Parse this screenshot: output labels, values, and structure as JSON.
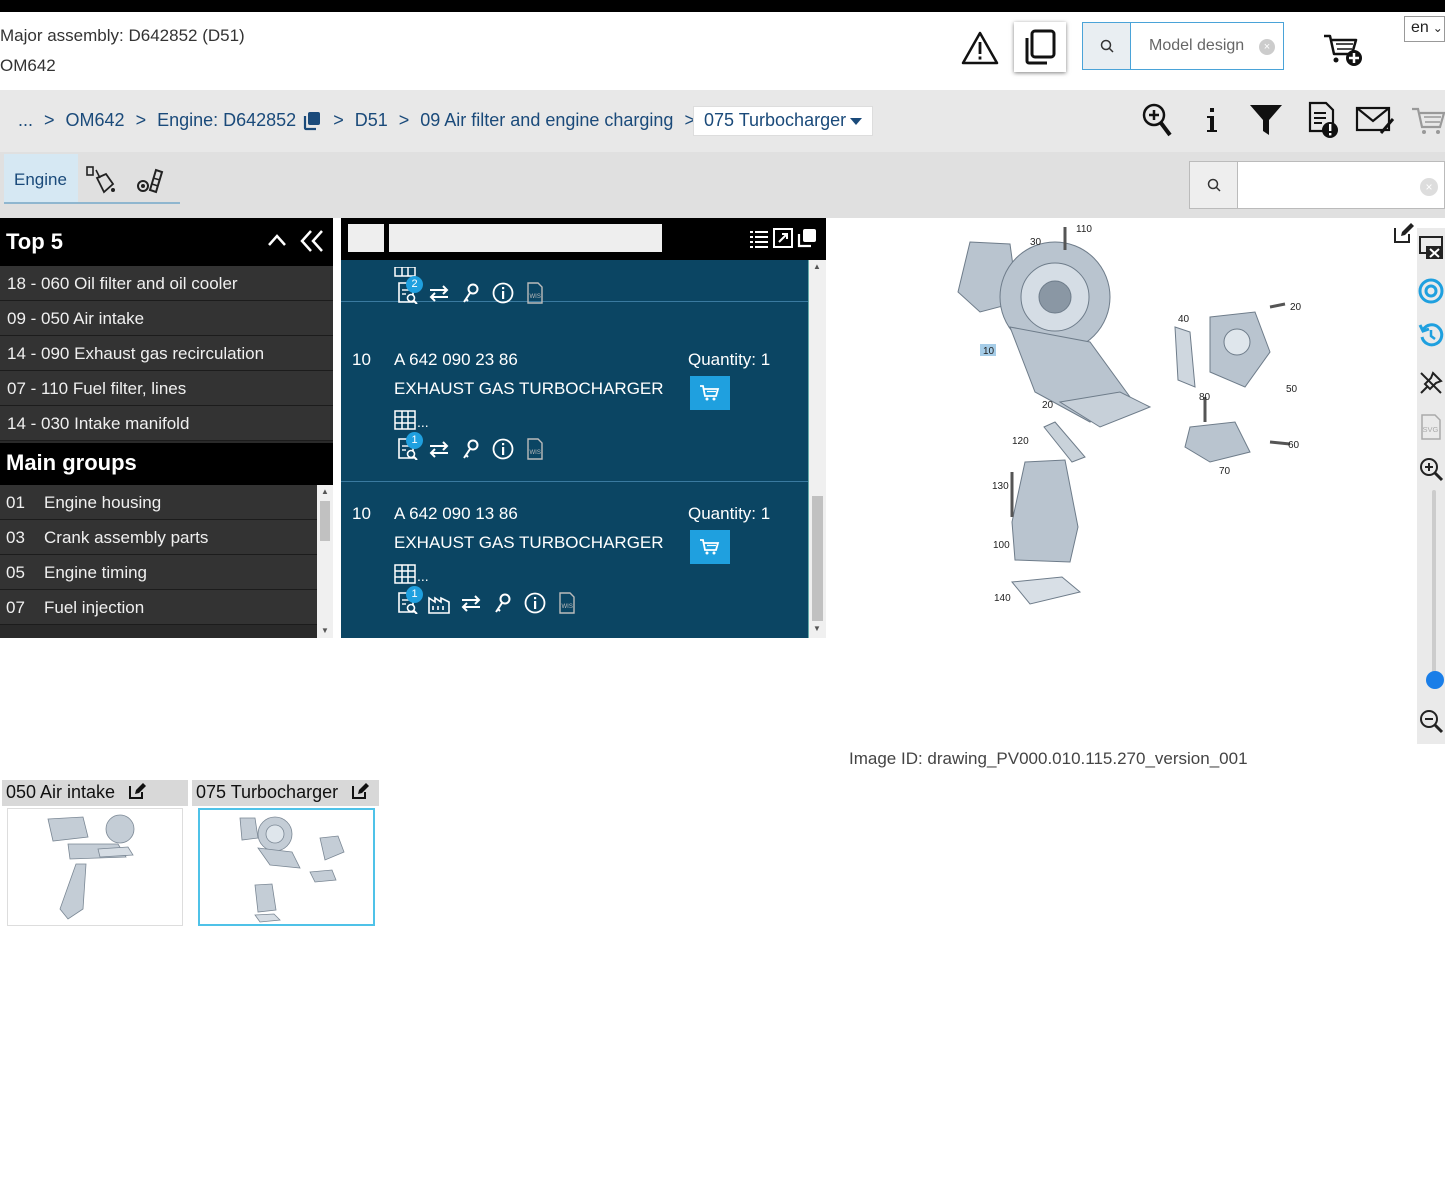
{
  "header": {
    "major_assembly": "Major assembly: D642852 (D51)",
    "engine_code": "OM642",
    "model_search_placeholder": "Model design",
    "language": "en"
  },
  "breadcrumb": {
    "items": [
      "...",
      "OM642",
      "Engine: D642852",
      "D51",
      "09 Air filter and engine charging"
    ],
    "current": "075 Turbocharger"
  },
  "tabs": {
    "engine_label": "Engine"
  },
  "top5": {
    "title": "Top 5",
    "items": [
      "18 - 060 Oil filter and oil cooler",
      "09 - 050 Air intake",
      "14 - 090 Exhaust gas recirculation",
      "07 - 110 Fuel filter, lines",
      "14 - 030 Intake manifold"
    ]
  },
  "main_groups": {
    "title": "Main groups",
    "items": [
      {
        "num": "01",
        "label": "Engine housing"
      },
      {
        "num": "03",
        "label": "Crank assembly parts"
      },
      {
        "num": "05",
        "label": "Engine timing"
      },
      {
        "num": "07",
        "label": "Fuel injection"
      }
    ]
  },
  "parts": [
    {
      "badge": "2"
    },
    {
      "pos": "10",
      "number": "A 642 090 23 86",
      "name": "EXHAUST GAS TURBOCHARGER",
      "quantity": "Quantity: 1",
      "badge": "1",
      "table_more": "..."
    },
    {
      "pos": "10",
      "number": "A 642 090 13 86",
      "name": "EXHAUST GAS TURBOCHARGER",
      "quantity": "Quantity: 1",
      "badge": "1",
      "table_more": "..."
    }
  ],
  "drawing": {
    "image_id": "Image ID: drawing_PV000.010.115.270_version_001",
    "callouts": [
      "110",
      "30",
      "20",
      "40",
      "10",
      "50",
      "80",
      "20",
      "120",
      "60",
      "70",
      "130",
      "100",
      "140"
    ]
  },
  "thumbnails": [
    {
      "label": "050 Air intake"
    },
    {
      "label": "075 Turbocharger"
    }
  ],
  "colors": {
    "accent": "#1fa0df",
    "panel": "#0b4563",
    "link": "#1a4a7a"
  }
}
